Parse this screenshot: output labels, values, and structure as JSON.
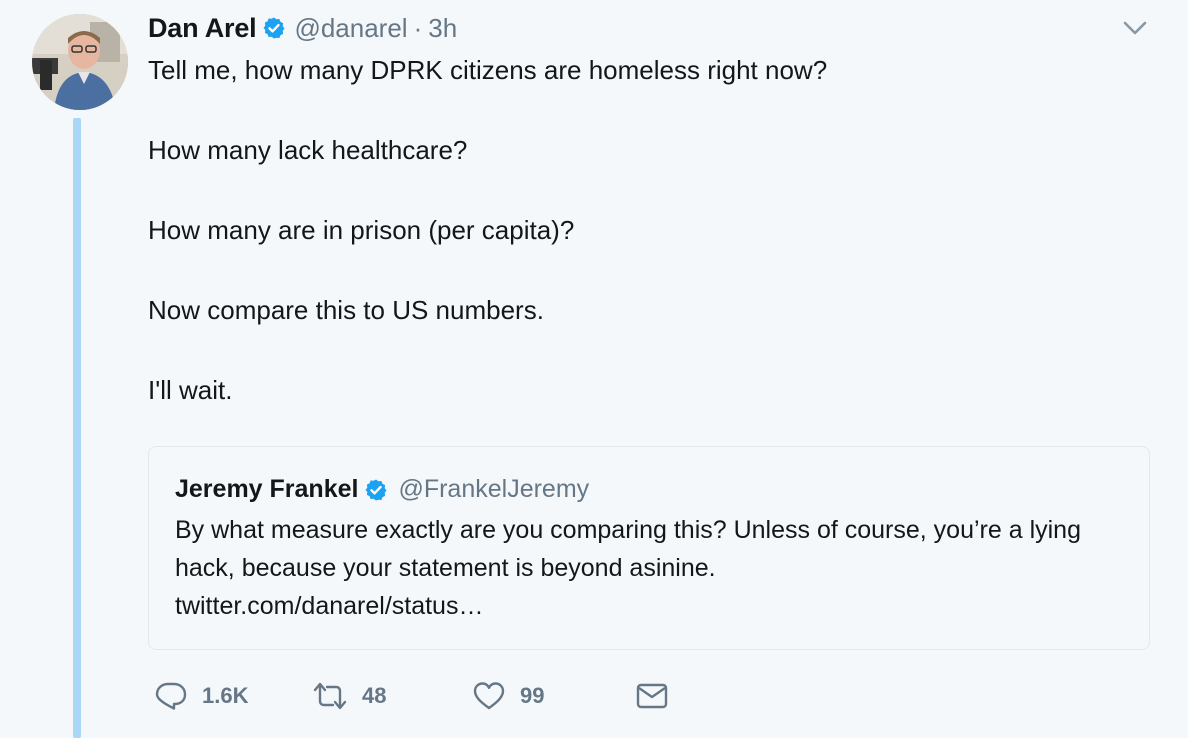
{
  "tweet": {
    "author_name": "Dan Arel",
    "author_handle": "@danarel",
    "separator": "·",
    "time": "3h",
    "lines": [
      "Tell me, how many DPRK citizens are homeless right now?",
      "How many lack healthcare?",
      "How many are in prison (per capita)?",
      "Now compare this to US numbers.",
      "I'll wait."
    ]
  },
  "quote": {
    "author_name": "Jeremy Frankel",
    "author_handle": "@FrankelJeremy",
    "text": "By what measure exactly are you comparing this? Unless of course, you’re a lying hack, because your statement is beyond asinine.",
    "link": "twitter.com/danarel/status…"
  },
  "actions": {
    "reply_count": "1.6K",
    "retweet_count": "48",
    "like_count": "99"
  },
  "icons": {
    "verified": "verified-badge-icon",
    "caret": "chevron-down-icon",
    "reply": "reply-icon",
    "retweet": "retweet-icon",
    "like": "heart-icon",
    "dm": "envelope-icon"
  },
  "colors": {
    "background": "#f5f8fa",
    "verified_blue": "#1da1f2",
    "thread_line": "#a8d7f7",
    "muted_text": "#657786"
  }
}
